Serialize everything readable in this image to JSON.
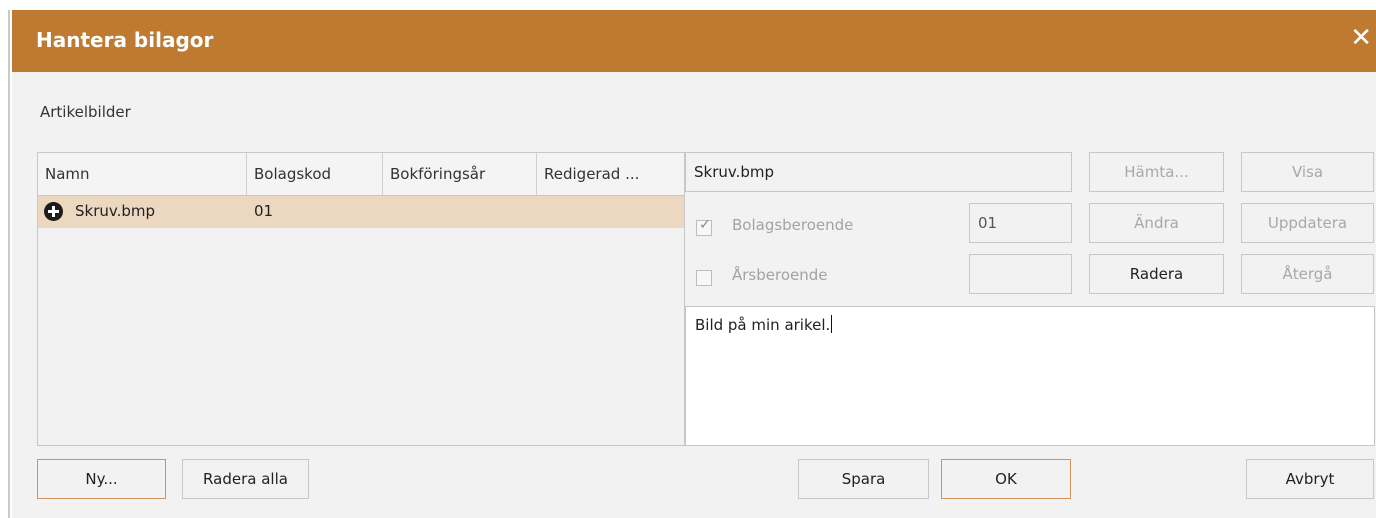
{
  "dialog": {
    "title": "Hantera bilagor",
    "close_glyph": "✕",
    "section_label": "Artikelbilder"
  },
  "grid": {
    "columns": [
      "Namn",
      "Bolagskod",
      "Bokföringsår",
      "Redigerad ..."
    ],
    "rows": [
      {
        "icon": "plus-circle-icon",
        "name": "Skruv.bmp",
        "bolagskod": "01",
        "bokforingsar": "",
        "redigerad": ""
      }
    ]
  },
  "detail": {
    "filename": "Skruv.bmp",
    "hamta_label": "Hämta...",
    "visa_label": "Visa",
    "bolagsberoende_label": "Bolagsberoende",
    "bolagsberoende_checked": true,
    "bolagsberoende_value": "01",
    "andra_label": "Ändra",
    "uppdatera_label": "Uppdatera",
    "arsberoende_label": "Årsberoende",
    "arsberoende_checked": false,
    "arsberoende_value": "",
    "radera_label": "Radera",
    "atergа_label": "Återgå",
    "description": "Bild på min arikel."
  },
  "footer": {
    "ny_label": "Ny...",
    "radera_alla_label": "Radera alla",
    "spara_label": "Spara",
    "ok_label": "OK",
    "avbryt_label": "Avbryt"
  },
  "colors": {
    "titlebar": "#bd7a30",
    "selected_row": "#ecd7c0",
    "accent_border": "#d1925b"
  }
}
